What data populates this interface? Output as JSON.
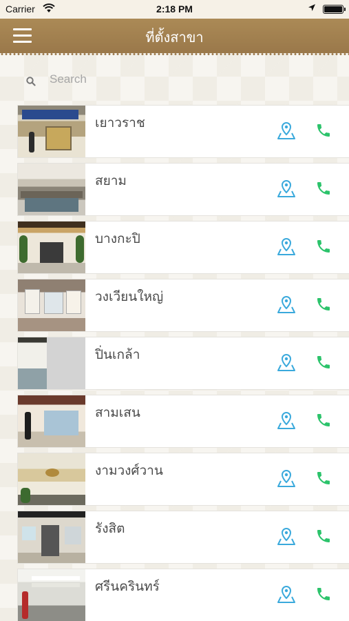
{
  "status_bar": {
    "carrier": "Carrier",
    "time": "2:18 PM"
  },
  "nav": {
    "title": "ที่ตั้งสาขา",
    "menu_icon": "hamburger-menu-icon"
  },
  "search": {
    "placeholder": "Search",
    "value": ""
  },
  "colors": {
    "nav_bg": "#a07f4f",
    "map_icon": "#3aa9dc",
    "phone_icon": "#2cc36b",
    "text": "#4a4a4a"
  },
  "branches": [
    {
      "name": "เยาวราช"
    },
    {
      "name": "สยาม"
    },
    {
      "name": "บางกะปิ"
    },
    {
      "name": "วงเวียนใหญ่"
    },
    {
      "name": "ปิ่นเกล้า"
    },
    {
      "name": "สามเสน"
    },
    {
      "name": "งามวงศ์วาน"
    },
    {
      "name": "รังสิต"
    },
    {
      "name": "ศรีนครินทร์"
    }
  ]
}
